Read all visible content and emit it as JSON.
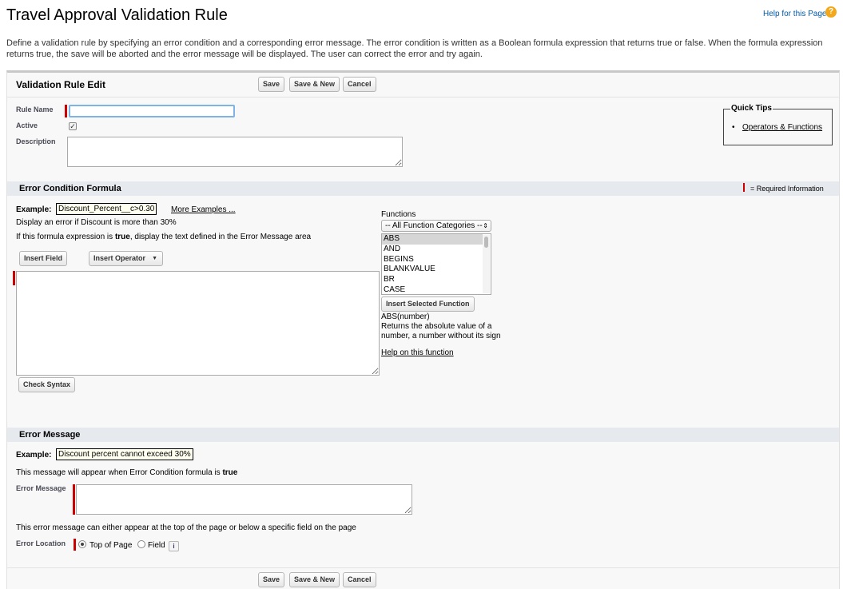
{
  "page": {
    "title": "Travel Approval Validation Rule",
    "help_link": "Help for this Page",
    "help_icon": "?",
    "intro": "Define a validation rule by specifying an error condition and a corresponding error message. The error condition is written as a Boolean formula expression that returns true or false. When the formula expression returns true, the save will be aborted and the error message will be displayed. The user can correct the error and try again."
  },
  "panel": {
    "title": "Validation Rule Edit",
    "buttons": {
      "save": "Save",
      "save_new": "Save & New",
      "cancel": "Cancel"
    }
  },
  "rule": {
    "rule_name_label": "Rule Name",
    "rule_name_value": "",
    "active_label": "Active",
    "active_checked": true,
    "checkmark": "✓",
    "description_label": "Description",
    "description_value": ""
  },
  "quick_tips": {
    "title": "Quick Tips",
    "bullet": "•",
    "link": "Operators & Functions"
  },
  "error_condition": {
    "section_title": "Error Condition Formula",
    "required_legend": "= Required Information",
    "example_label": "Example:",
    "example_value": "Discount_Percent__c>0.30",
    "more_examples": "More Examples ...",
    "example_desc": "Display an error if Discount is more than 30%",
    "instruction_prefix": "If this formula expression is ",
    "instruction_bold": "true",
    "instruction_suffix": ", display the text defined in the Error Message area",
    "insert_field": "Insert Field",
    "insert_operator": "Insert Operator",
    "dropdown_arrow": "▼",
    "formula_value": "",
    "check_syntax": "Check Syntax"
  },
  "functions": {
    "label": "Functions",
    "category_selected": "-- All Function Categories --",
    "items": [
      "ABS",
      "AND",
      "BEGINS",
      "BLANKVALUE",
      "BR",
      "CASE"
    ],
    "selected_index": 0,
    "insert_button": "Insert Selected Function",
    "signature": "ABS(number)",
    "description": "Returns the absolute value of a number, a number without its sign",
    "help_link": "Help on this function"
  },
  "error_message": {
    "section_title": "Error Message",
    "example_label": "Example:",
    "example_value": "Discount percent cannot exceed 30%",
    "appear_prefix": "This message will appear when Error Condition formula is ",
    "appear_bold": "true",
    "field_label": "Error Message",
    "field_value": "",
    "location_note": "This error message can either appear at the top of the page or below a specific field on the page",
    "location_label": "Error Location",
    "location_options": [
      "Top of Page",
      "Field"
    ],
    "location_selected": "Top of Page",
    "info_icon": "i"
  }
}
